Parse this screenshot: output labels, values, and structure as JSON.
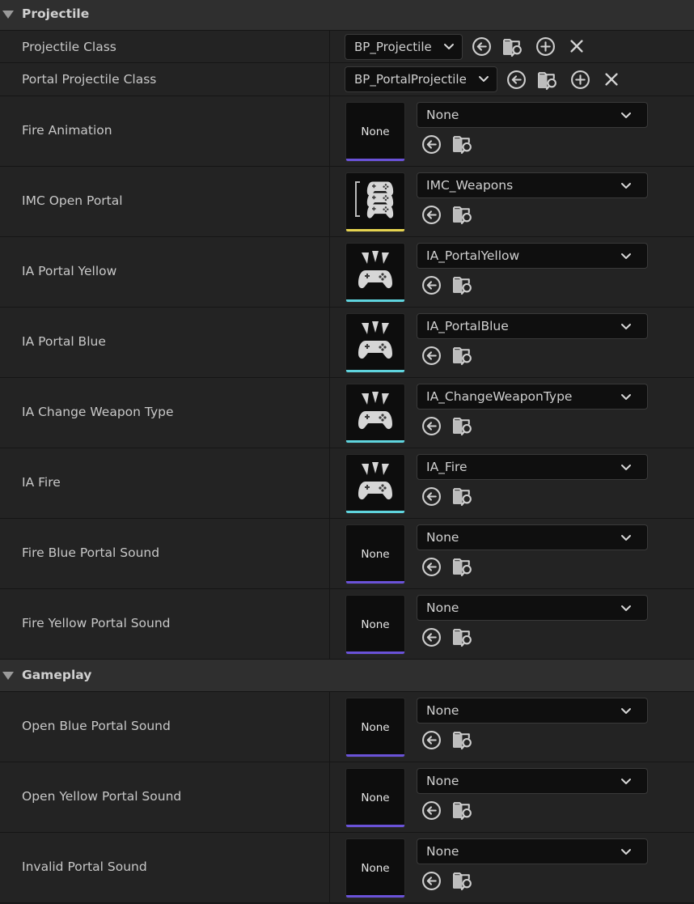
{
  "sections": {
    "projectile": {
      "title": "Projectile"
    },
    "gameplay": {
      "title": "Gameplay"
    }
  },
  "projectile_class": {
    "label": "Projectile Class",
    "value": "BP_Projectile"
  },
  "portal_projectile_class": {
    "label": "Portal Projectile Class",
    "value": "BP_PortalProjectile"
  },
  "asset_rows": [
    {
      "label": "Fire Animation",
      "value": "None",
      "thumb": "None",
      "thumb_icon": "none",
      "bar_color": "#6a52d8"
    },
    {
      "label": "IMC Open Portal",
      "value": "IMC_Weapons",
      "thumb": "",
      "thumb_icon": "mapping-context-icon",
      "bar_color": "#e6d450"
    },
    {
      "label": "IA Portal Yellow",
      "value": "IA_PortalYellow",
      "thumb": "",
      "thumb_icon": "input-action-icon",
      "bar_color": "#5fd4de"
    },
    {
      "label": "IA Portal Blue",
      "value": "IA_PortalBlue",
      "thumb": "",
      "thumb_icon": "input-action-icon",
      "bar_color": "#5fd4de"
    },
    {
      "label": "IA Change Weapon Type",
      "value": "IA_ChangeWeaponType",
      "thumb": "",
      "thumb_icon": "input-action-icon",
      "bar_color": "#5fd4de"
    },
    {
      "label": "IA Fire",
      "value": "IA_Fire",
      "thumb": "",
      "thumb_icon": "input-action-icon",
      "bar_color": "#5fd4de"
    },
    {
      "label": "Fire Blue Portal Sound",
      "value": "None",
      "thumb": "None",
      "thumb_icon": "none",
      "bar_color": "#6a52d8"
    },
    {
      "label": "Fire Yellow Portal Sound",
      "value": "None",
      "thumb": "None",
      "thumb_icon": "none",
      "bar_color": "#6a52d8"
    },
    {
      "label": "Open Blue Portal Sound",
      "value": "None",
      "thumb": "None",
      "thumb_icon": "none",
      "bar_color": "#6a52d8"
    },
    {
      "label": "Open Yellow Portal Sound",
      "value": "None",
      "thumb": "None",
      "thumb_icon": "none",
      "bar_color": "#6a52d8"
    },
    {
      "label": "Invalid Portal Sound",
      "value": "None",
      "thumb": "None",
      "thumb_icon": "none",
      "bar_color": "#6a52d8"
    }
  ]
}
